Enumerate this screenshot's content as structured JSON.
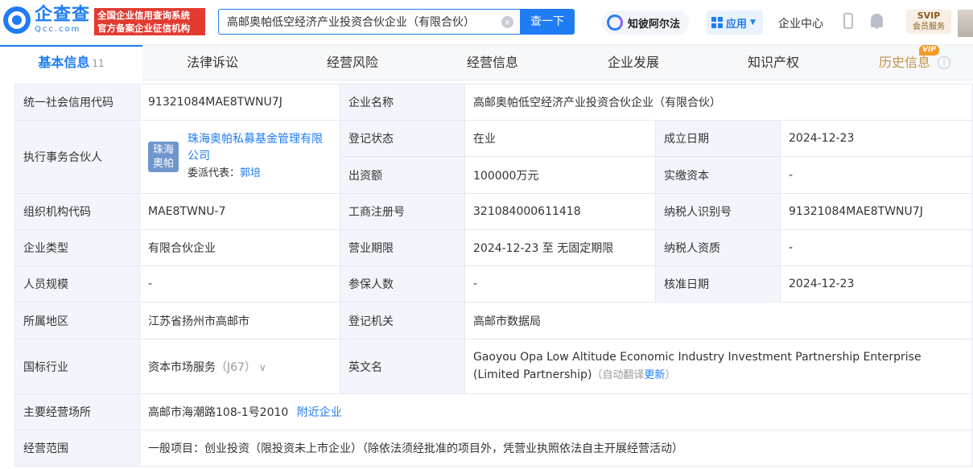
{
  "header": {
    "logo_cn": "企查查",
    "logo_en": "Qcc.com",
    "badge_line1": "全国企业信用查询系统",
    "badge_line2": "官方备案企业征信机构",
    "search_value": "高邮奥帕低空经济产业投资合伙企业（有限合伙）",
    "clear_symbol": "×",
    "search_button": "查一下",
    "ai_label": "知彼阿尔法",
    "app_label": "应用",
    "center_label": "企业中心",
    "svip_title": "SVIP",
    "svip_sub": "会员服务"
  },
  "tabs": [
    {
      "label": "基本信息",
      "count": "11"
    },
    {
      "label": "法律诉讼"
    },
    {
      "label": "经营风险"
    },
    {
      "label": "经营信息"
    },
    {
      "label": "企业发展"
    },
    {
      "label": "知识产权"
    },
    {
      "label": "历史信息",
      "tag": "VIP"
    }
  ],
  "info": {
    "credit_code_label": "统一社会信用代码",
    "credit_code": "91321084MAE8TWNU7J",
    "company_name_label": "企业名称",
    "company_name": "高邮奥帕低空经济产业投资合伙企业（有限合伙）",
    "partner_label": "执行事务合伙人",
    "partner_logo": "珠海奥帕",
    "partner_name": "珠海奥帕私募基金管理有限公司",
    "delegate_label": "委派代表：",
    "delegate_name": "郭培",
    "status_label": "登记状态",
    "status": "在业",
    "found_date_label": "成立日期",
    "found_date": "2024-12-23",
    "capital_label": "出资额",
    "capital": "100000万元",
    "paid_capital_label": "实缴资本",
    "paid_capital": "-",
    "org_code_label": "组织机构代码",
    "org_code": "MAE8TWNU-7",
    "reg_no_label": "工商注册号",
    "reg_no": "321084000611418",
    "taxpayer_id_label": "纳税人识别号",
    "taxpayer_id": "91321084MAE8TWNU7J",
    "type_label": "企业类型",
    "type": "有限合伙企业",
    "term_label": "营业期限",
    "term": "2024-12-23 至 无固定期限",
    "taxpayer_qual_label": "纳税人资质",
    "taxpayer_qual": "-",
    "staff_label": "人员规模",
    "staff": "-",
    "insured_label": "参保人数",
    "insured": "-",
    "approve_date_label": "核准日期",
    "approve_date": "2024-12-23",
    "region_label": "所属地区",
    "region": "江苏省扬州市高邮市",
    "authority_label": "登记机关",
    "authority": "高邮市数据局",
    "industry_label": "国标行业",
    "industry": "资本市场服务",
    "industry_code": "（J67）",
    "english_label": "英文名",
    "english_name": "Gaoyou Opa Low Altitude Economic Industry Investment Partnership Enterprise (Limited Partnership)",
    "auto_translate": "（自动翻译",
    "update_link": "更新",
    "close_paren": "）",
    "address_label": "主要经营场所",
    "address": "高邮市海潮路108-1号2010",
    "nearby_link": "附近企业",
    "scope_label": "经营范围",
    "scope": "一般项目：创业投资（限投资未上市企业）（除依法须经批准的项目外，凭营业执照依法自主开展经营活动）"
  }
}
